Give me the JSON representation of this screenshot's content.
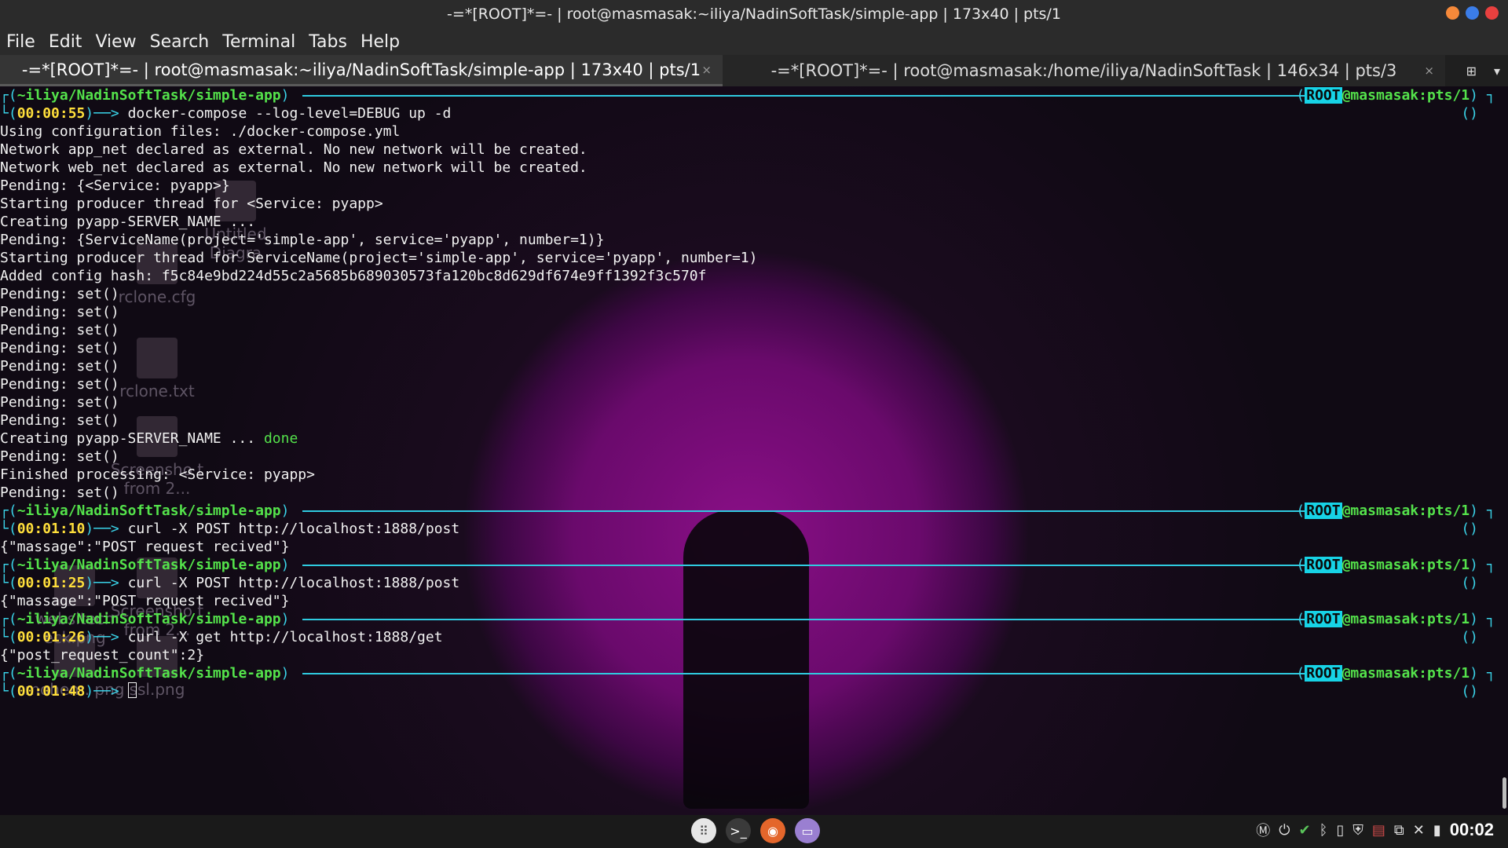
{
  "window": {
    "title": "-=*[ROOT]*=- | root@masmasak:~iliya/NadinSoftTask/simple-app | 173x40 | pts/1",
    "buttons": [
      {
        "name": "minimize",
        "color": "#f6893a"
      },
      {
        "name": "maximize",
        "color": "#3b7de8"
      },
      {
        "name": "close",
        "color": "#e8403f"
      }
    ]
  },
  "menu": [
    "File",
    "Edit",
    "View",
    "Search",
    "Terminal",
    "Tabs",
    "Help"
  ],
  "tabs": [
    {
      "label": "-=*[ROOT]*=- | root@masmasak:~iliya/NadinSoftTask/simple-app | 173x40 | pts/1",
      "active": true,
      "close": "×"
    },
    {
      "label": "-=*[ROOT]*=- | root@masmasak:/home/iliya/NadinSoftTask | 146x34 | pts/3",
      "active": false,
      "close": "×"
    }
  ],
  "prompt": {
    "cwd": "~iliya/NadinSoftTask/simple-app",
    "root_badge": "ROOT",
    "host": "@masmasak:pts/1"
  },
  "session": [
    {
      "time": "00:00:55",
      "command": "docker-compose --log-level=DEBUG up -d",
      "output": [
        "Using configuration files: ./docker-compose.yml",
        "Network app_net declared as external. No new network will be created.",
        "Network web_net declared as external. No new network will be created.",
        "Pending: {<Service: pyapp>}",
        "Starting producer thread for <Service: pyapp>",
        "Creating pyapp-SERVER_NAME ...",
        "Pending: {ServiceName(project='simple-app', service='pyapp', number=1)}",
        "Starting producer thread for ServiceName(project='simple-app', service='pyapp', number=1)",
        "Added config hash: f5c84e9bd224d55c2a5685b689030573fa120bc8d629df674e9ff1392f3c570f",
        "Pending: set()",
        "Pending: set()",
        "Pending: set()",
        "Pending: set()",
        "Pending: set()",
        "Pending: set()",
        "Pending: set()",
        "Pending: set()",
        {
          "text": "Creating pyapp-SERVER_NAME ... ",
          "status": "done"
        },
        "Pending: set()",
        "Finished processing: <Service: pyapp>",
        "Pending: set()"
      ]
    },
    {
      "time": "00:01:10",
      "command": "curl -X POST http://localhost:1888/post",
      "output": [
        "{\"massage\":\"POST request recived\"}"
      ]
    },
    {
      "time": "00:01:25",
      "command": "curl -X POST http://localhost:1888/post",
      "output": [
        "{\"massage\":\"POST request recived\"}"
      ]
    },
    {
      "time": "00:01:26",
      "command": "curl -X get http://localhost:1888/get",
      "output": [
        "{\"post_request_count\":2}"
      ]
    },
    {
      "time": "00:01:48",
      "command": "",
      "output": []
    }
  ],
  "desktop_icons": [
    {
      "label": "Untitled Diagra",
      "icon": "file-icon"
    },
    {
      "label": "rclone.cfg",
      "icon": "file-icon"
    },
    {
      "label": "rclone.txt",
      "icon": "file-icon"
    },
    {
      "label": "Screensho t from 2...",
      "icon": "image-icon"
    },
    {
      "label": "Screensho t from 2...",
      "icon": "image-icon"
    },
    {
      "label": "ssl.png",
      "icon": "image-icon"
    },
    {
      "label": "mohem. png",
      "icon": "image-icon"
    },
    {
      "label": "websitech eck.png",
      "icon": "image-icon"
    }
  ],
  "panel": {
    "launchers": [
      "apps-grid-icon",
      "terminal-icon",
      "firefox-icon",
      "files-icon"
    ],
    "tray": [
      "mint-update-icon",
      "power-icon",
      "shield-check-icon",
      "bluetooth-icon",
      "clipboard-icon",
      "security-icon",
      "us-flag-icon",
      "network-icon",
      "volume-muted-icon",
      "battery-icon"
    ],
    "clock": "00:02"
  }
}
